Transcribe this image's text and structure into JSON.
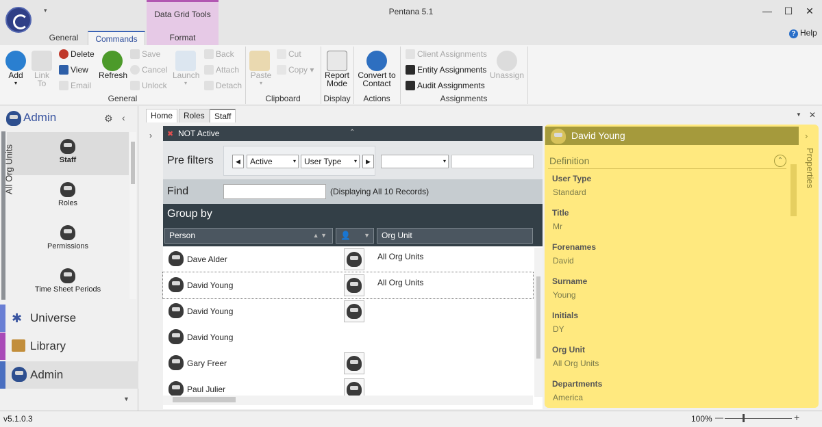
{
  "window": {
    "title": "Pentana 5.1",
    "qa_arrow": "▾",
    "min": "—",
    "max": "☐",
    "close": "✕"
  },
  "ribbon": {
    "contextual_group": "Data Grid Tools",
    "tabs": [
      "General",
      "Commands",
      "Format"
    ],
    "help": "Help",
    "general": {
      "add": "Add",
      "link": "Link",
      "to": "To",
      "delete": "Delete",
      "view": "View",
      "email": "Email",
      "refresh": "Refresh",
      "save": "Save",
      "cancel": "Cancel",
      "unlock": "Unlock",
      "launch": "Launch",
      "back": "Back",
      "attach": "Attach",
      "detach": "Detach",
      "group_label": "General"
    },
    "clipboard": {
      "paste": "Paste",
      "cut": "Cut",
      "copy": "Copy",
      "group_label": "Clipboard"
    },
    "display": {
      "report": "Report",
      "mode": "Mode",
      "group_label": "Display"
    },
    "actions": {
      "convert": "Convert to",
      "contact": "Contact",
      "group_label": "Actions"
    },
    "assignments": {
      "client": "Client Assignments",
      "entity": "Entity Assignments",
      "audit": "Audit Assignments",
      "unassign": "Unassign",
      "group_label": "Assignments"
    }
  },
  "nav": {
    "header": "Admin",
    "items": [
      "Staff",
      "Roles",
      "Permissions",
      "Time Sheet Periods"
    ],
    "workbench": [
      "Universe",
      "Library",
      "Admin"
    ]
  },
  "doc_tabs": [
    "Home",
    "Roles",
    "Staff"
  ],
  "side_tab": "All Org Units",
  "grid": {
    "filter_label": "NOT Active",
    "prefilters_label": "Pre filters",
    "prefilter_active": "Active",
    "prefilter_usertype": "User Type",
    "find_label": "Find",
    "find_value": "",
    "record_info": "(Displaying All 10 Records)",
    "group_by": "Group by",
    "columns": {
      "person": "Person",
      "org_unit": "Org Unit"
    },
    "rows": [
      {
        "person": "Dave Alder",
        "org": "All Org Units",
        "icon": true
      },
      {
        "person": "David Young",
        "org": "All Org Units",
        "icon": true
      },
      {
        "person": "David Young",
        "org": "",
        "icon": true
      },
      {
        "person": "David Young",
        "org": "",
        "icon": false
      },
      {
        "person": "Gary Freer",
        "org": "",
        "icon": true
      },
      {
        "person": "Paul Julier",
        "org": "",
        "icon": true
      }
    ]
  },
  "properties": {
    "title": "David Young",
    "section": "Definition",
    "side_label": "Properties",
    "fields": [
      {
        "label": "User Type",
        "value": "Standard"
      },
      {
        "label": "Title",
        "value": "Mr"
      },
      {
        "label": "Forenames",
        "value": "David"
      },
      {
        "label": "Surname",
        "value": "Young"
      },
      {
        "label": "Initials",
        "value": "DY"
      },
      {
        "label": "Org Unit",
        "value": "All Org Units"
      },
      {
        "label": "Departments",
        "value": "America"
      }
    ]
  },
  "status": {
    "version": "v5.1.0.3",
    "zoom": "100%"
  },
  "colors": {
    "accent": "#3b63b5",
    "contextual": "#b257b2",
    "grid_header": "#333f47",
    "props_bg": "#ffe97f",
    "props_head": "#a59a3c"
  }
}
